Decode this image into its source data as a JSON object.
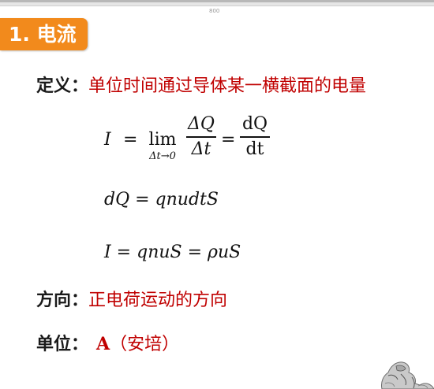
{
  "zoom_label": "800",
  "title": "1. 电流",
  "definition": {
    "label": "定义：",
    "text": "单位时间通过导体某一横截面的电量"
  },
  "equations": {
    "current_def": {
      "lhs": "I",
      "eq1": "=",
      "lim": "lim",
      "lim_sub": "Δt→0",
      "frac1_num": "ΔQ",
      "frac1_den": "Δt",
      "eq2": "=",
      "frac2_num": "dQ",
      "frac2_den": "dt"
    },
    "dq": "dQ = qnudtS",
    "current_micro": "I = qnuS = ρuS"
  },
  "direction": {
    "label": "方向：",
    "text": "正电荷运动的方向"
  },
  "unit": {
    "label": "单位：",
    "symbol": "A",
    "name": "（安培）"
  },
  "colors": {
    "accent_orange": "#f28a1c",
    "text_red": "#c00000",
    "text_dark": "#1a1a1a"
  },
  "decoration_icon": "thinker-statue-icon"
}
